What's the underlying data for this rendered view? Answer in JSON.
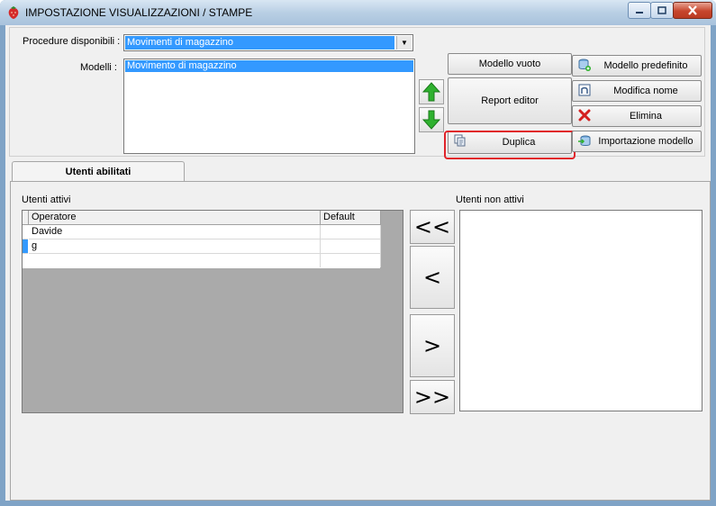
{
  "window": {
    "title": "IMPOSTAZIONE VISUALIZZAZIONI / STAMPE"
  },
  "form": {
    "procedure_label": "Procedure disponibili :",
    "procedure_value": "Movimenti di magazzino",
    "modelli_label": "Modelli :",
    "modelli_items": [
      "Movimento di magazzino"
    ]
  },
  "buttons": {
    "modello_vuoto": "Modello vuoto",
    "report_editor": "Report editor",
    "duplica": "Duplica",
    "modello_predefinito": "Modello predefinito",
    "modifica_nome": "Modifica nome",
    "elimina": "Elimina",
    "importazione_modello": "Importazione modello"
  },
  "tabs": {
    "utenti_abilitati": "Utenti abilitati"
  },
  "users": {
    "active_label": "Utenti attivi",
    "inactive_label": "Utenti non attivi",
    "columns": [
      "Operatore",
      "Default"
    ],
    "rows": [
      {
        "operatore": "Davide",
        "default": ""
      },
      {
        "operatore": "g",
        "default": ""
      }
    ],
    "move_all_left": "<<",
    "move_left": "<",
    "move_right": ">",
    "move_all_right": ">>"
  },
  "icons": {
    "app": "strawberry-icon",
    "up": "green-up-arrow-icon",
    "down": "green-down-arrow-icon",
    "duplica": "copy-document-icon",
    "predefinito": "database-add-icon",
    "modifica": "n-letter-icon",
    "elimina": "red-x-icon",
    "importazione": "import-database-icon"
  },
  "colors": {
    "selection": "#3399ff",
    "highlight": "#e0242a",
    "arrow_green": "#2fb12f"
  }
}
